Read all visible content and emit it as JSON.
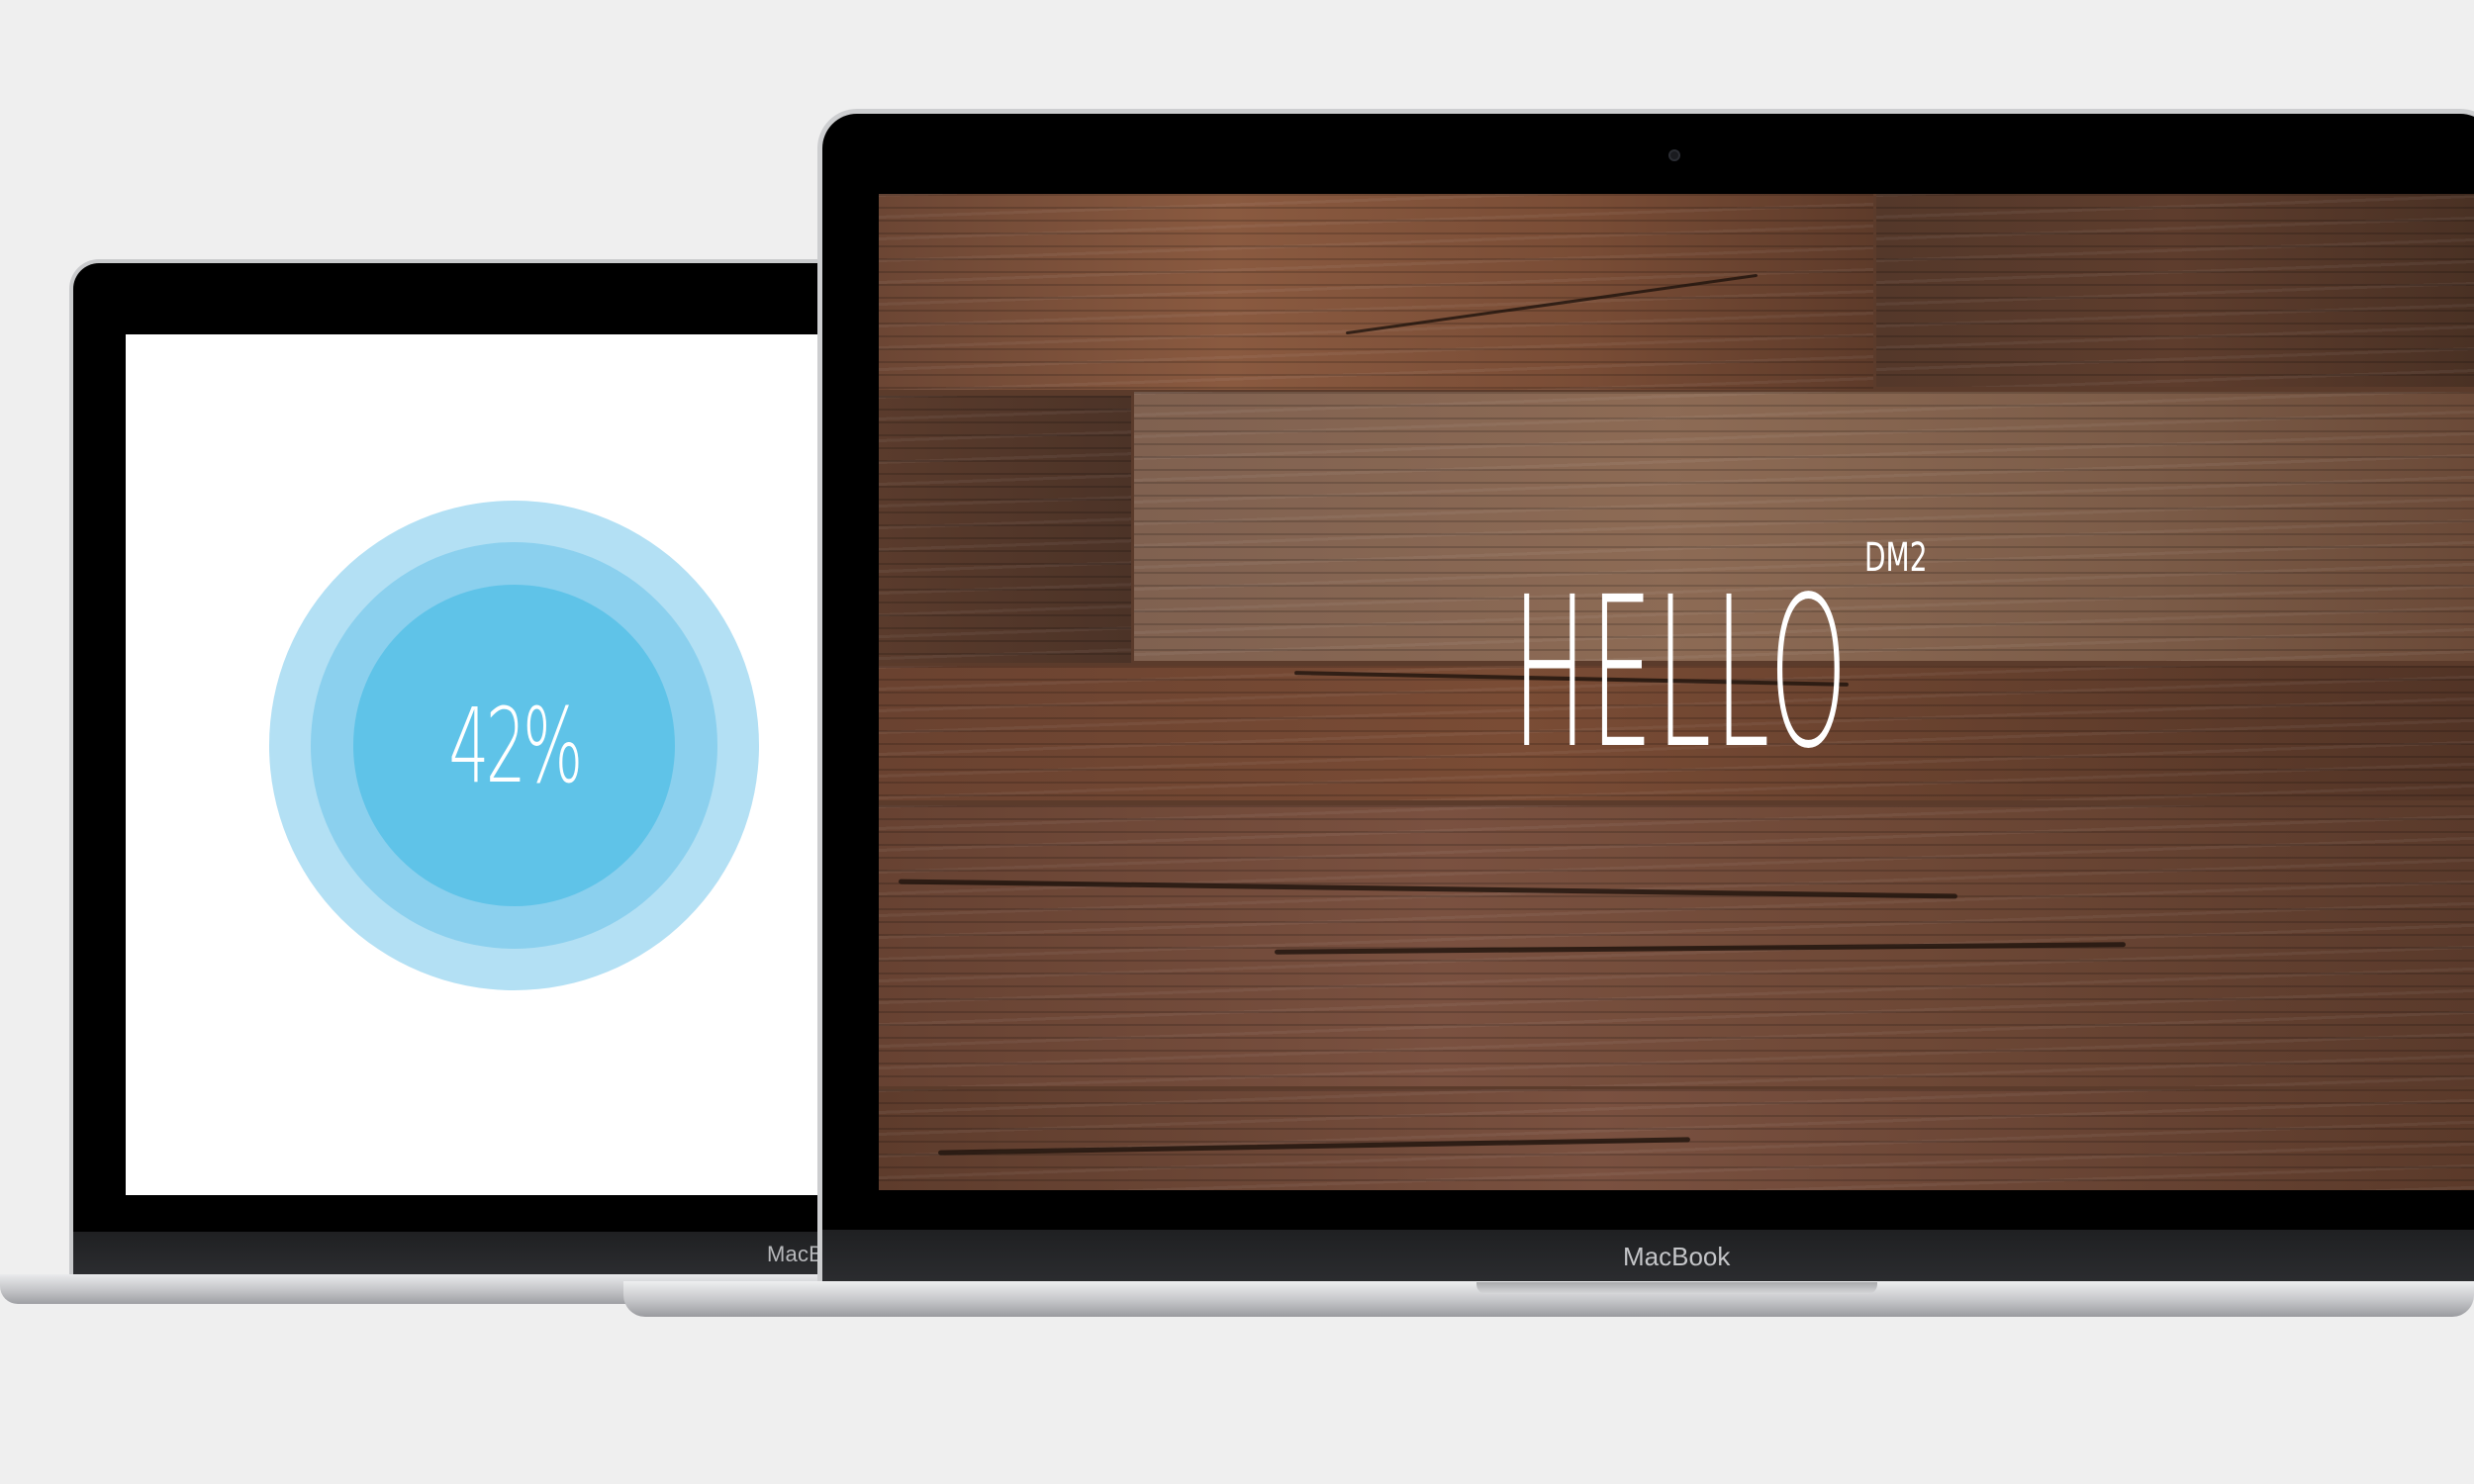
{
  "small_laptop": {
    "brand": "MacBook",
    "screen": {
      "progress_value": "42%",
      "progress_fraction": 0.42,
      "ring_colors": [
        "#b3e0f4",
        "#8bd0ee",
        "#5fc3e8"
      ]
    }
  },
  "large_laptop": {
    "brand": "MacBook",
    "screen": {
      "title": "HELLO",
      "superscript": "DM2",
      "background": "wood-plank-texture"
    }
  },
  "colors": {
    "page_background": "#efefef",
    "bezel": "#000000",
    "aluminum": "#c8c9cc"
  }
}
